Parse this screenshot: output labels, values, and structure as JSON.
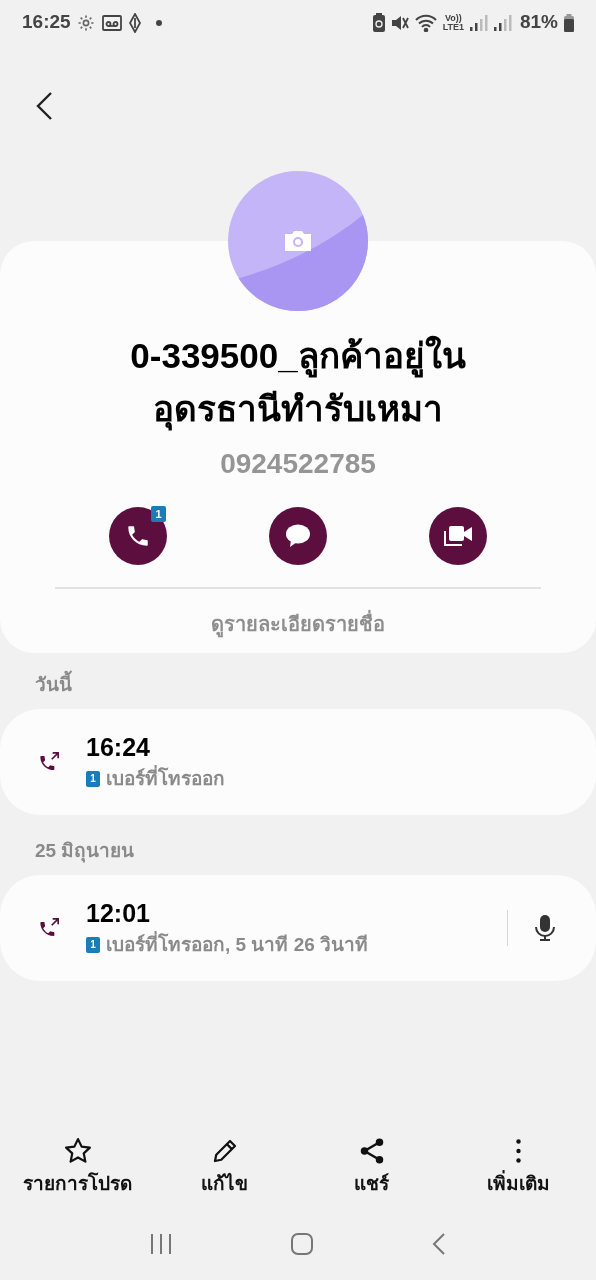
{
  "status_bar": {
    "time": "16:25",
    "volte": "Vo))",
    "lte": "LTE1",
    "battery": "81%"
  },
  "contact": {
    "name_lines": [
      "0-339500_ลูกค้าอยู่ใน",
      "อุดรธานีทำรับเหมา"
    ],
    "phone": "0924522785"
  },
  "actions": [
    {
      "kind": "call",
      "badge": "1"
    },
    {
      "kind": "message"
    },
    {
      "kind": "video"
    }
  ],
  "details_link": "ดูรายละเอียดรายชื่อ",
  "call_groups": [
    {
      "date": "วันนี้",
      "calls": [
        {
          "kind": "outgoing",
          "time": "16:24",
          "sim": "1",
          "description": "เบอร์ที่โทรออก",
          "recorded": false
        }
      ]
    },
    {
      "date": "25 มิถุนายน",
      "calls": [
        {
          "kind": "outgoing",
          "time": "12:01",
          "sim": "1",
          "description": "เบอร์ที่โทรออก, 5 นาที 26 วินาที",
          "recorded": true
        }
      ]
    }
  ],
  "bottom_bar": [
    {
      "kind": "favorite",
      "label": "รายการโปรด"
    },
    {
      "kind": "edit",
      "label": "แก้ไข"
    },
    {
      "kind": "share",
      "label": "แชร์"
    },
    {
      "kind": "more",
      "label": "เพิ่มเติม"
    }
  ]
}
